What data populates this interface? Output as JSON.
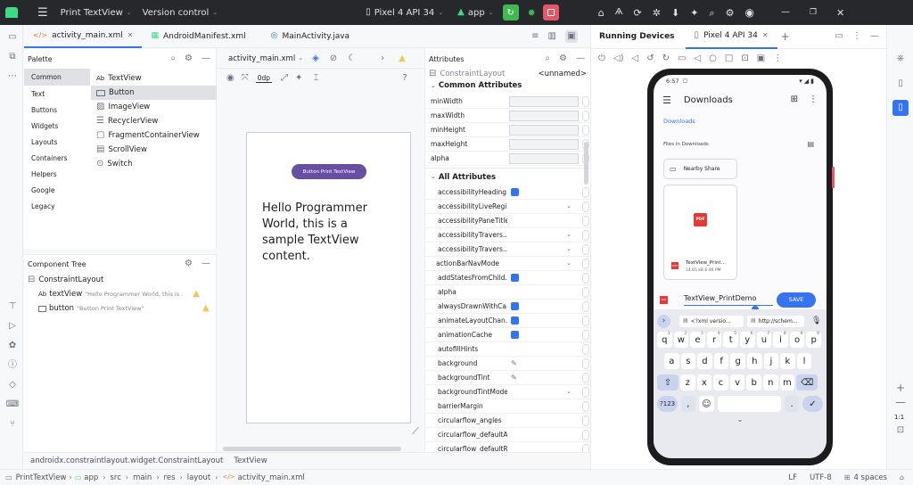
{
  "titlebar": {
    "project": "Print TextView",
    "vcs": "Version control",
    "device": "Pixel 4 API 34",
    "module": "app"
  },
  "editor_tabs": [
    "activity_main.xml",
    "AndroidManifest.xml",
    "MainActivity.java"
  ],
  "palette": {
    "title": "Palette",
    "categories": [
      "Common",
      "Text",
      "Buttons",
      "Widgets",
      "Layouts",
      "Containers",
      "Helpers",
      "Google",
      "Legacy"
    ],
    "widgets": [
      "TextView",
      "Button",
      "ImageView",
      "RecyclerView",
      "FragmentContainerView",
      "ScrollView",
      "Switch"
    ],
    "widget_prefix": "Ab"
  },
  "component_tree": {
    "title": "Component Tree",
    "root": "ConstraintLayout",
    "nodes": [
      {
        "prefix": "Ab",
        "name": "textView",
        "desc": "\"Hello Programmer World, this is ..."
      },
      {
        "prefix": "",
        "name": "button",
        "desc": "\"Button Print TextView\""
      }
    ]
  },
  "design": {
    "file": "activity_main.xml",
    "margin": "0dp",
    "button_text": "Button Print TextView",
    "text_content": "Hello Programmer World, this is a sample TextView content."
  },
  "attributes": {
    "title": "Attributes",
    "component": "ConstraintLayout",
    "id_value": "<unnamed>",
    "common_title": "Common Attributes",
    "common": [
      "minWidth",
      "maxWidth",
      "minHeight",
      "maxHeight",
      "alpha"
    ],
    "all_title": "All Attributes",
    "all": [
      {
        "name": "accessibilityHeading",
        "ctrl": "check"
      },
      {
        "name": "accessibilityLiveRegi...",
        "ctrl": "dropdown"
      },
      {
        "name": "accessibilityPaneTitle",
        "ctrl": "none"
      },
      {
        "name": "accessibilityTravers...",
        "ctrl": "dropdown"
      },
      {
        "name": "accessibilityTravers...",
        "ctrl": "dropdown"
      },
      {
        "name": "actionBarNavMode",
        "ctrl": "dropdown"
      },
      {
        "name": "addStatesFromChild...",
        "ctrl": "check"
      },
      {
        "name": "alpha",
        "ctrl": "none"
      },
      {
        "name": "alwaysDrawnWithCa...",
        "ctrl": "check"
      },
      {
        "name": "animateLayoutChan...",
        "ctrl": "check"
      },
      {
        "name": "animationCache",
        "ctrl": "check"
      },
      {
        "name": "autofillHints",
        "ctrl": "none"
      },
      {
        "name": "background",
        "ctrl": "pick"
      },
      {
        "name": "backgroundTint",
        "ctrl": "pick"
      },
      {
        "name": "backgroundTintMode",
        "ctrl": "dropdown"
      },
      {
        "name": "barrierMargin",
        "ctrl": "none"
      },
      {
        "name": "circularflow_angles",
        "ctrl": "none"
      },
      {
        "name": "circularflow_defaultA...",
        "ctrl": "none"
      },
      {
        "name": "circularflow_defaultR...",
        "ctrl": "none"
      }
    ]
  },
  "running_devices": {
    "title": "Running Devices",
    "tab": "Pixel 4 API 34",
    "zoom": "1:1"
  },
  "phone": {
    "time": "6:57",
    "app_title": "Downloads",
    "breadcrumb": "Downloads",
    "section": "Files in Downloads",
    "folder": "Nearby Share",
    "pdf_badge": "PDF",
    "file_name": "TextView_Print...",
    "file_meta": "14.65 kB 6:46 PM",
    "input_value": "TextView_PrintDemo",
    "save_label": "SAVE",
    "suggestions": [
      "<?xml versio...",
      "http://schem..."
    ],
    "keys_row1": [
      "q",
      "w",
      "e",
      "r",
      "t",
      "y",
      "u",
      "i",
      "o",
      "p"
    ],
    "keys_row1_hints": [
      "1",
      "2",
      "3",
      "4",
      "5",
      "6",
      "7",
      "8",
      "9",
      "0"
    ],
    "keys_row2": [
      "a",
      "s",
      "d",
      "f",
      "g",
      "h",
      "j",
      "k",
      "l"
    ],
    "keys_row3": [
      "z",
      "x",
      "c",
      "v",
      "b",
      "n",
      "m"
    ],
    "sym_key": "?123",
    "comma": ",",
    "period": "."
  },
  "breadcrumb_bottom": [
    "androidx.constraintlayout.widget.ConstraintLayout",
    "TextView"
  ],
  "statusbar": {
    "path": [
      "PrintTextView",
      "app",
      "src",
      "main",
      "res",
      "layout",
      "activity_main.xml"
    ],
    "lf": "LF",
    "encoding": "UTF-8",
    "indent": "4 spaces"
  },
  "colors": {
    "accent": "#3574f0",
    "button_purple": "#6750a4",
    "run_green": "#3fb950",
    "stop_red": "#e55765",
    "warning": "#f2c55c"
  }
}
